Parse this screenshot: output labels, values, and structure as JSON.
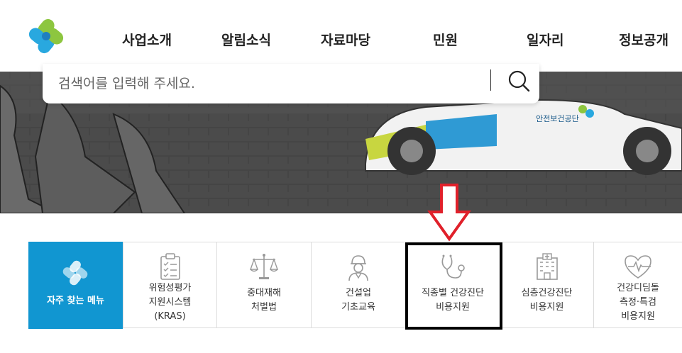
{
  "nav": {
    "items": [
      "사업소개",
      "알림소식",
      "자료마당",
      "민원",
      "일자리",
      "정보공개"
    ]
  },
  "search": {
    "placeholder": "검색어를 입력해 주세요."
  },
  "banner": {
    "vehicle_text": "안전보건공단"
  },
  "quick_menu": {
    "title": "자주 찾는 메뉴",
    "items": [
      {
        "lines": [
          "위험성평가",
          "지원시스템",
          "(KRAS)"
        ],
        "icon": "clipboard-checklist-icon"
      },
      {
        "lines": [
          "중대재해",
          "처벌법"
        ],
        "icon": "scales-icon"
      },
      {
        "lines": [
          "건설업",
          "기초교육"
        ],
        "icon": "construction-worker-icon"
      },
      {
        "lines": [
          "직종별 건강진단",
          "비용지원"
        ],
        "icon": "stethoscope-icon"
      },
      {
        "lines": [
          "심층건강진단",
          "비용지원"
        ],
        "icon": "hospital-building-icon"
      },
      {
        "lines": [
          "건강디딤돌",
          "측정·특검",
          "비용지원"
        ],
        "icon": "heart-pulse-icon"
      }
    ]
  },
  "colors": {
    "accent": "#1196d1",
    "logo_green": "#8dc63f",
    "logo_blue": "#29a8df",
    "highlight_arrow": "#e0202a"
  }
}
